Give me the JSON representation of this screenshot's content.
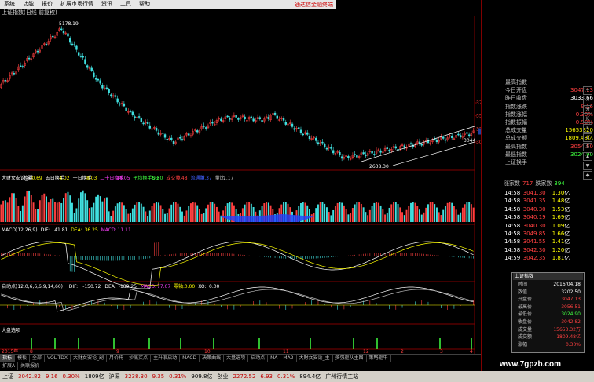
{
  "menu": [
    "系统",
    "功能",
    "报价",
    "扩展市场行情",
    "资讯",
    "工具",
    "帮助"
  ],
  "menu_notice": "通达信金融终端",
  "title": "上证指数(日线 前复权)",
  "chart": {
    "peak_label": "5178.19",
    "low_label": "2638.30",
    "price_ticks": [
      "3750",
      "3500",
      "3250",
      "3000"
    ],
    "current_price_tag": "3202.5",
    "current_price_right": "3044",
    "turnover_header": {
      "title": "大财女安论_副",
      "k1": "换手",
      "v1": "0.69",
      "k2": "五日换手",
      "v2": "4.02",
      "k3": "十日换手",
      "v3": "8.03",
      "k4": "二十日换手",
      "v4": "16.05",
      "k5": "平均换手5日",
      "v5": "0.80",
      "k6": "成交量",
      "v6": "0.48",
      "k7": "流通股",
      "v7": "0.37",
      "k8": "量比",
      "v8": "1.17"
    },
    "turnover_ticks": [
      "3.00",
      "2.00",
      "1.00"
    ],
    "macd_header": {
      "name": "MACD(12,26,9)",
      "k1": "DIF:",
      "v1": "41.81",
      "k2": "DEA:",
      "v2": "36.25",
      "k3": "MACD:",
      "v3": "11.11"
    },
    "macd_ticks": [
      "150.0",
      "50.0",
      "0.00"
    ],
    "qd_header": {
      "name": "启动点(12,0,6,6,6,9,14,60)",
      "k1": "DIF:",
      "v1": "-150.72",
      "k2": "DEA:",
      "v2": "-189.25",
      "k3": "MACD:",
      "v3": "77.07",
      "k4": "零轴:",
      "v4": "0.00",
      "k5": "XO:",
      "v5": "0.00"
    },
    "qd_ticks": [
      "100.00",
      "0.00",
      "-100.00",
      "-200.00"
    ],
    "dp_header": "大盘选项",
    "dp_ticks": [
      "1.00",
      "0.50"
    ],
    "x_labels": [
      "2015年",
      "8",
      "9",
      "10",
      "11",
      "12",
      "2",
      "3",
      "4"
    ]
  },
  "right_panel": {
    "rows": [
      {
        "label": "最高指数",
        "value": "",
        "cls": "red"
      },
      {
        "label": "今日开盘",
        "value": "3047.13",
        "cls": "red"
      },
      {
        "label": "昨日收盘",
        "value": "3033.66",
        "cls": "white"
      },
      {
        "label": "指数涨跌",
        "value": "9.16",
        "cls": "red"
      },
      {
        "label": "指数涨幅",
        "value": "0.30%",
        "cls": "red"
      },
      {
        "label": "指数振幅",
        "value": "0.98%",
        "cls": "red"
      },
      {
        "label": "总成交量",
        "value": "15653320",
        "cls": "yellow"
      },
      {
        "label": "总成交额",
        "value": "1809.48亿",
        "cls": "yellow"
      },
      {
        "label": "最高指数",
        "value": "3054.50",
        "cls": "red"
      },
      {
        "label": "最低指数",
        "value": "3024.90",
        "cls": "green"
      },
      {
        "label": "上证换手",
        "value": "",
        "cls": "white"
      }
    ],
    "updown_label1": "涨家数",
    "updown_val1": "717",
    "updown_label2": "跌家数",
    "updown_val2": "394",
    "trades": [
      {
        "time": "14:58",
        "price": "3041.30",
        "vol": "1.30"
      },
      {
        "time": "14:58",
        "price": "3041.35",
        "vol": "1.48"
      },
      {
        "time": "14:58",
        "price": "3040.30",
        "vol": "1.53"
      },
      {
        "time": "14:58",
        "price": "3040.19",
        "vol": "1.69"
      },
      {
        "time": "14:58",
        "price": "3040.30",
        "vol": "1.09"
      },
      {
        "time": "14:58",
        "price": "3049.85",
        "vol": "1.66"
      },
      {
        "time": "14:58",
        "price": "3041.55",
        "vol": "1.41"
      },
      {
        "time": "14:58",
        "price": "3042.30",
        "vol": "1.20"
      },
      {
        "time": "14:59",
        "price": "3042.35",
        "vol": "1.81"
      }
    ],
    "trade_vol_unit": "亿",
    "tip": {
      "header": "上证指数",
      "rows": [
        {
          "k": "时间",
          "v": "2016/04/18"
        },
        {
          "k": "数值",
          "v": "3202.50"
        },
        {
          "k": "开盘价",
          "v": "3047.13"
        },
        {
          "k": "最高价",
          "v": "3056.51"
        },
        {
          "k": "最低价",
          "v": "3024.90"
        },
        {
          "k": "收盘价",
          "v": "3042.82"
        },
        {
          "k": "成交量",
          "v": "15653.32万"
        },
        {
          "k": "成交额",
          "v": "1809.48亿"
        },
        {
          "k": "涨幅",
          "v": "0.30%"
        }
      ]
    },
    "side_icons": [
      "+",
      "×",
      "分",
      "K",
      "F",
      "L",
      "S",
      "▲",
      "▼",
      "◆"
    ]
  },
  "tabs": [
    "指标",
    "模板",
    "全部",
    "VOL-TDX",
    "大财女安论_副",
    "月价托",
    "抄底买点",
    "主升浪启动",
    "MACD",
    "决策曲线",
    "大盘选项",
    "启动点",
    "MA",
    "MA2",
    "大财女安论_主",
    "多强驱队主图",
    "策略驱牛"
  ],
  "tabs_active": 0,
  "tabs2": [
    "扩展A",
    "关联报价"
  ],
  "status": [
    {
      "t": "上证",
      "c": ""
    },
    {
      "t": "3042.82",
      "c": "sred"
    },
    {
      "t": "9.16",
      "c": "sred"
    },
    {
      "t": "0.30%",
      "c": "sred"
    },
    {
      "t": "1809亿",
      "c": ""
    },
    {
      "t": "沪深",
      "c": ""
    },
    {
      "t": "3238.30",
      "c": "sred"
    },
    {
      "t": "9.35",
      "c": "sred"
    },
    {
      "t": "0.31%",
      "c": "sred"
    },
    {
      "t": "909.8亿",
      "c": ""
    },
    {
      "t": "创业",
      "c": ""
    },
    {
      "t": "2272.52",
      "c": "sred"
    },
    {
      "t": "6.93",
      "c": "sred"
    },
    {
      "t": "0.31%",
      "c": "sred"
    },
    {
      "t": "894.4亿",
      "c": ""
    },
    {
      "t": "广州行情主站",
      "c": ""
    }
  ],
  "watermark": "www.7gpzb.com",
  "colors": {
    "up": "#ff4040",
    "down": "#40e0e0",
    "bg": "#000000"
  }
}
